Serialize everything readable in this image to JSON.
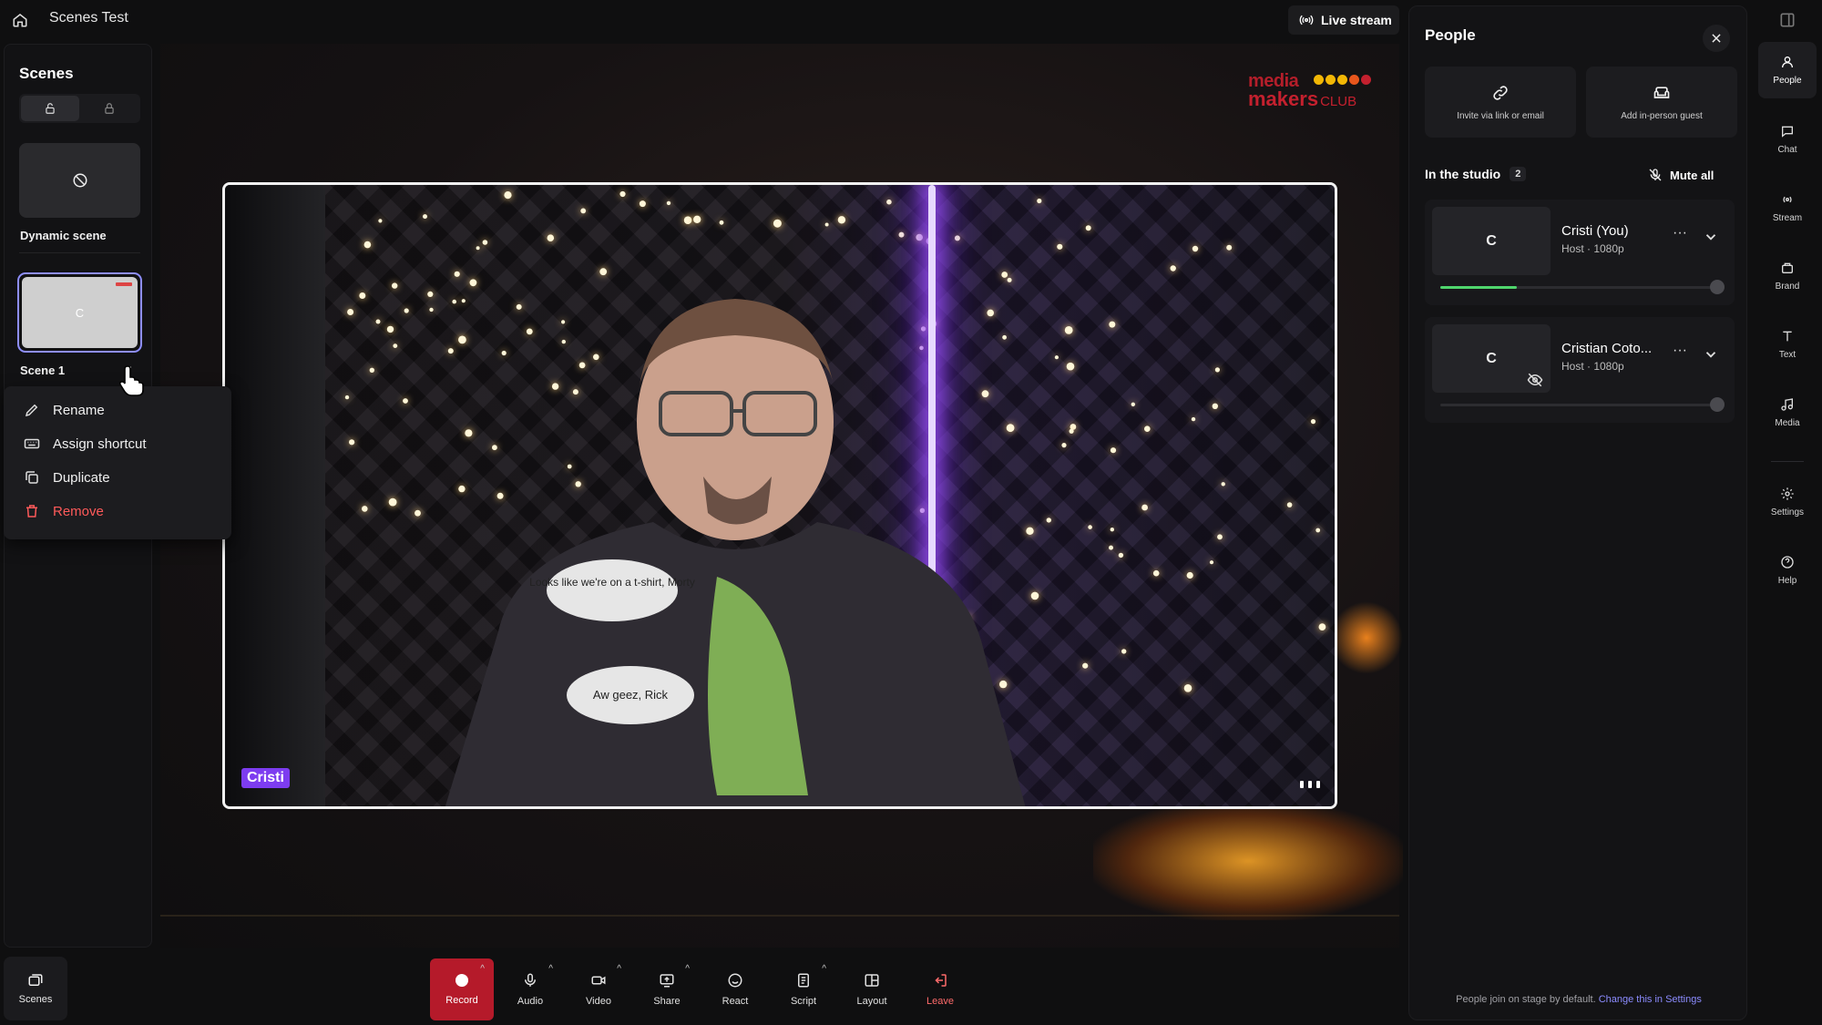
{
  "topbar": {
    "title": "Scenes Test",
    "live_label": "Live stream"
  },
  "scenes": {
    "title": "Scenes",
    "items": [
      {
        "label": "Dynamic scene"
      },
      {
        "label": "Scene 1",
        "thumb_letter": "C"
      }
    ],
    "more_label": "··"
  },
  "context_menu": {
    "items": [
      {
        "label": "Rename",
        "icon": "pencil-icon"
      },
      {
        "label": "Assign shortcut",
        "icon": "keyboard-icon"
      },
      {
        "label": "Duplicate",
        "icon": "duplicate-icon"
      },
      {
        "label": "Remove",
        "icon": "trash-icon",
        "color": "#ff5a5a"
      }
    ]
  },
  "stage": {
    "logo_line1": "media",
    "logo_line2": "makers",
    "logo_line2_small": "CLUB",
    "logo_dot_colors": [
      "#f2b705",
      "#f2b705",
      "#f2b705",
      "#e8561c",
      "#c4202e"
    ],
    "name_tag": "Cristi",
    "shirt_text_top": "Looks like we're on a t-shirt, Morty",
    "shirt_text_bottom": "Aw geez, Rick"
  },
  "toolbar": {
    "scenes_label": "Scenes",
    "items": [
      {
        "label": "Record",
        "icon": "record-icon",
        "has_caret": true
      },
      {
        "label": "Audio",
        "icon": "microphone-icon",
        "has_caret": true
      },
      {
        "label": "Video",
        "icon": "camera-icon",
        "has_caret": true
      },
      {
        "label": "Share",
        "icon": "screen-share-icon",
        "has_caret": true
      },
      {
        "label": "React",
        "icon": "smiley-icon",
        "has_caret": false
      },
      {
        "label": "Script",
        "icon": "script-icon",
        "has_caret": true
      },
      {
        "label": "Layout",
        "icon": "layout-icon",
        "has_caret": false
      },
      {
        "label": "Leave",
        "icon": "leave-icon",
        "has_caret": false
      }
    ],
    "caret": "^",
    "record_color": "#b51a2a"
  },
  "people": {
    "title": "People",
    "invite_label": "Invite via link or email",
    "in_person_label": "Add in-person guest",
    "studio_heading": "In the studio",
    "studio_count": "2",
    "mute_all": "Mute all",
    "participants": [
      {
        "initial": "C",
        "name": "Cristi (You)",
        "sub": "Host · 1080p",
        "audio_level": 0.28
      },
      {
        "initial": "C",
        "name": "Cristian Coto...",
        "sub": "Host · 1080p",
        "audio_level": 0
      }
    ],
    "footer_text": "People join on stage by default.",
    "footer_link": "Change this in Settings"
  },
  "rail": {
    "items": [
      {
        "label": "People",
        "icon": "people-icon"
      },
      {
        "label": "Chat",
        "icon": "chat-icon"
      },
      {
        "label": "Stream",
        "icon": "stream-icon"
      },
      {
        "label": "Brand",
        "icon": "brand-icon"
      },
      {
        "label": "Text",
        "icon": "text-icon"
      },
      {
        "label": "Media",
        "icon": "media-icon"
      },
      {
        "label": "Settings",
        "icon": "gear-icon"
      },
      {
        "label": "Help",
        "icon": "help-icon"
      }
    ]
  },
  "colors": {
    "accent": "#8e8eff",
    "audio_green": "#4fd66d",
    "danger": "#ff5a5a",
    "name_tag": "#7d3cf0"
  }
}
